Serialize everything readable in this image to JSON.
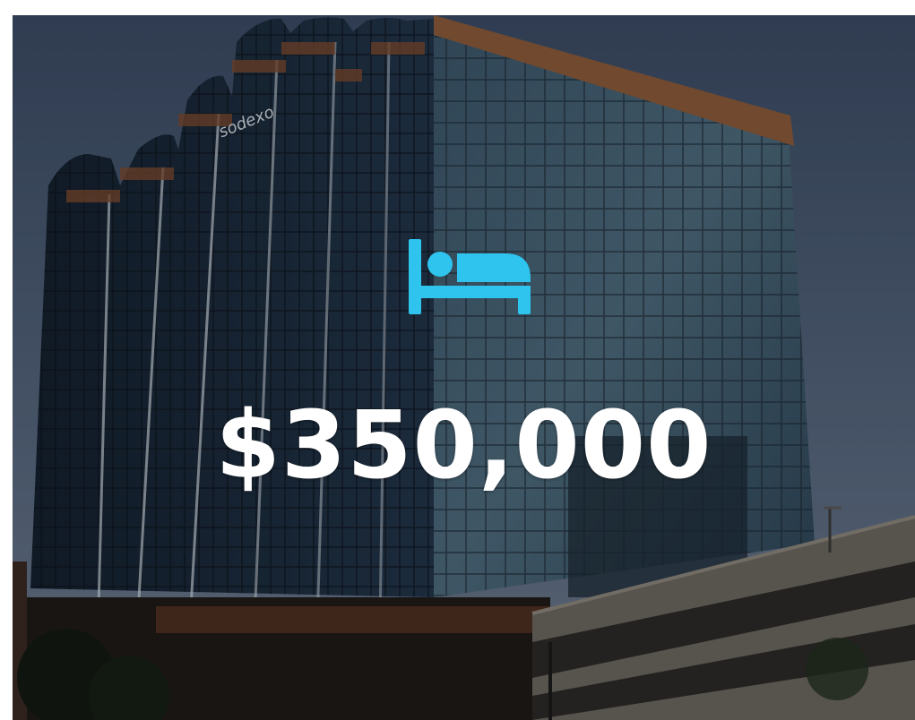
{
  "tile": {
    "icon": "bed-icon",
    "icon_color": "#2ec4ee",
    "price": "$350,000",
    "price_color": "#ffffff",
    "building_sign": "sodexo"
  }
}
